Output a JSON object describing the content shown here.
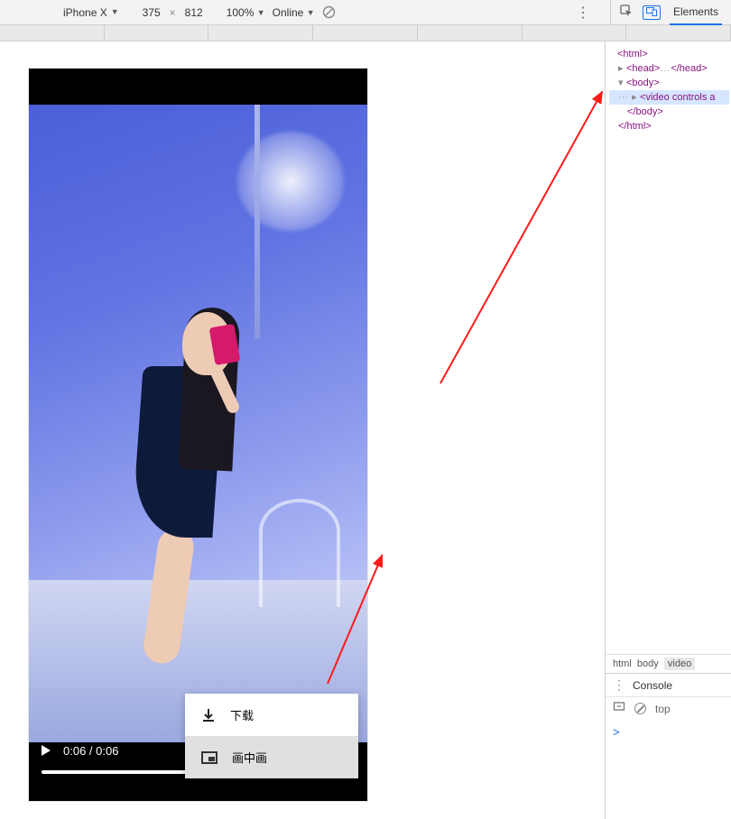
{
  "toolbar": {
    "device": "iPhone X",
    "width": "375",
    "height": "812",
    "zoom": "100%",
    "throttle": "Online",
    "elements_tab": "Elements"
  },
  "video": {
    "time_current": "0:06",
    "time_total": "0:06"
  },
  "context_menu": {
    "download": "下载",
    "pip": "画中画"
  },
  "dom": {
    "l1": "<html>",
    "l2_open": "<head>",
    "l2_dots": "…",
    "l2_close": "</head>",
    "l3": "<body>",
    "l4": "<video controls a",
    "l5": "</body>",
    "l6": "</html>"
  },
  "breadcrumb": {
    "a": "html",
    "b": "body",
    "c": "video"
  },
  "console": {
    "label": "Console",
    "context": "top",
    "prompt": ">"
  }
}
